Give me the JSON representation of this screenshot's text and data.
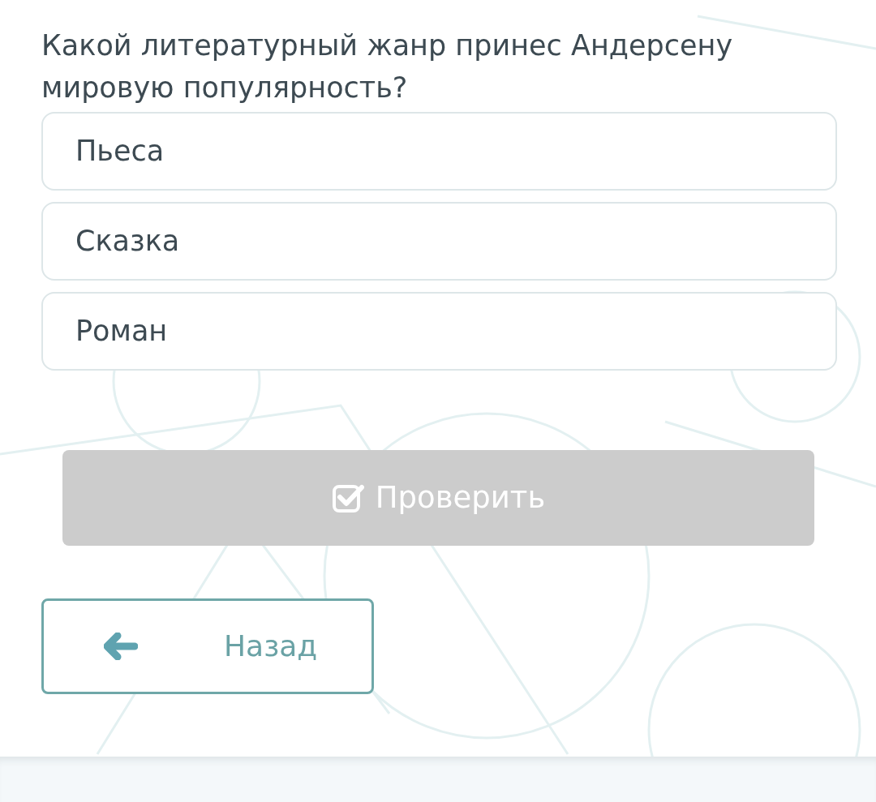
{
  "question": "Какой литературный жанр принес Андерсену мировую популярность?",
  "options": [
    {
      "label": "Пьеса",
      "selected": false
    },
    {
      "label": "Сказка",
      "selected": false
    },
    {
      "label": "Роман",
      "selected": false
    }
  ],
  "check_button": {
    "label": "Проверить",
    "disabled": true
  },
  "back_button": {
    "label": "Назад"
  }
}
